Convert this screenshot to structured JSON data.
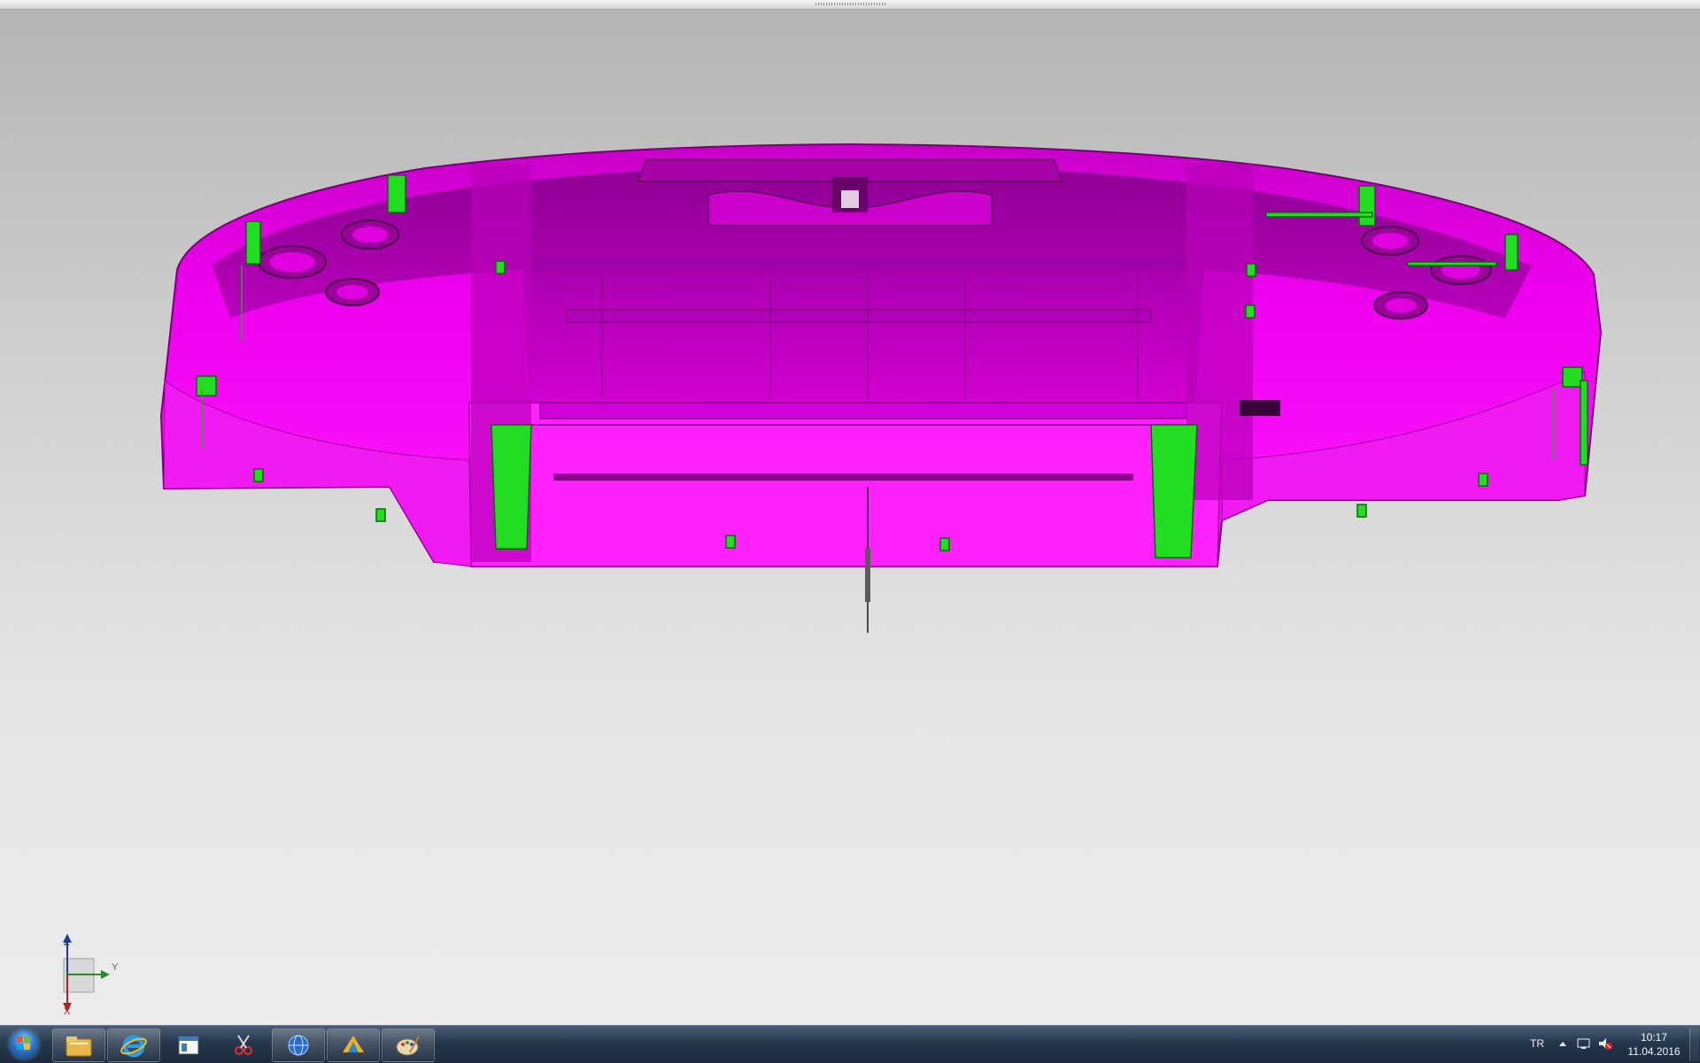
{
  "viewport": {
    "model_name": "bumper-3d-model",
    "model_color": "#ff00ff",
    "clip_color": "#22dd22",
    "background_top": "#b4b4b4",
    "background_bottom": "#ececec"
  },
  "triad": {
    "axis_z": "Z",
    "axis_y": "Y",
    "axis_x": "X"
  },
  "taskbar": {
    "apps": [
      {
        "icon": "file-explorer-icon"
      },
      {
        "icon": "internet-explorer-icon"
      },
      {
        "icon": "document-window-icon"
      },
      {
        "icon": "snipping-tool-icon"
      },
      {
        "icon": "globe-app-icon"
      },
      {
        "icon": "cad-app-icon"
      },
      {
        "icon": "paint-icon"
      }
    ],
    "tray": {
      "language": "TR",
      "time": "10:17",
      "date": "11.04.2016"
    }
  }
}
